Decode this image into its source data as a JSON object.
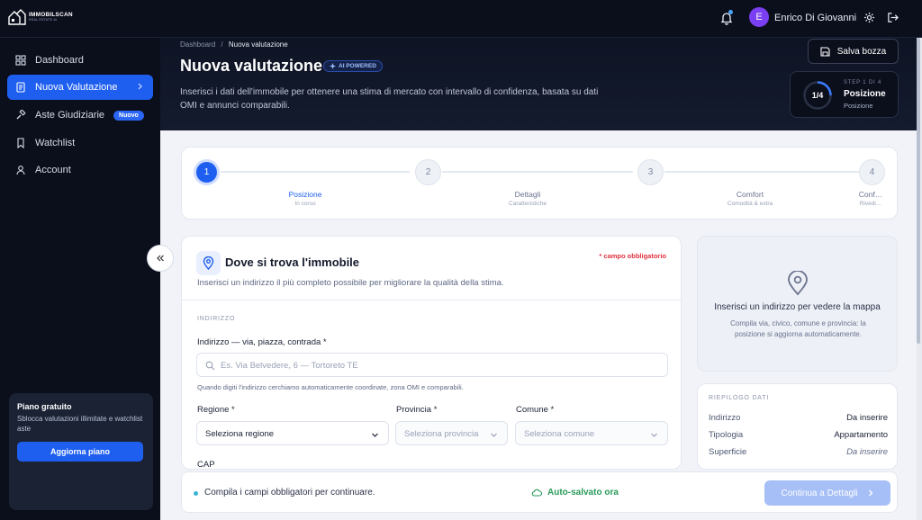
{
  "app": {
    "logo_name": "IMMOBILSCAN",
    "logo_tagline": "REAL ESTATE AI"
  },
  "topbar": {
    "user_initial": "E",
    "user_name": "Enrico Di Giovanni"
  },
  "sidebar": {
    "items": [
      {
        "label": "Dashboard",
        "icon": "dashboard-icon"
      },
      {
        "label": "Nuova Valutazione",
        "icon": "document-icon"
      },
      {
        "label": "Aste Giudiziarie",
        "icon": "gavel-icon",
        "badge": "Nuovo"
      },
      {
        "label": "Watchlist",
        "icon": "bookmark-icon"
      },
      {
        "label": "Account",
        "icon": "user-icon"
      }
    ],
    "promo": {
      "title": "Piano gratuito",
      "text": "Sblocca valutazioni illimitate e watchlist aste",
      "button": "Aggiorna piano"
    }
  },
  "header": {
    "breadcrumb_root": "Dashboard",
    "breadcrumb_sep": "/",
    "breadcrumb_current": "Nuova valutazione",
    "title": "Nuova valutazione",
    "ai_badge": "AI POWERED",
    "subtitle": "Inserisci i dati dell'immobile per ottenere una stima di mercato con intervallo di confidenza, basata su dati OMI e annunci comparabili.",
    "save_button": "Salva bozza",
    "step_fraction": "1/4",
    "step_of": "STEP 1 DI 4",
    "step_title": "Posizione",
    "step_subtitle": "Posizione",
    "step_progress": 0.25
  },
  "stepper": {
    "steps": [
      {
        "number": "1",
        "label": "Posizione",
        "sub": "In corso",
        "active": true
      },
      {
        "number": "2",
        "label": "Dettagli",
        "sub": "Caratteristiche",
        "active": false
      },
      {
        "number": "3",
        "label": "Comfort",
        "sub": "Comodità & extra",
        "active": false
      },
      {
        "number": "4",
        "label": "Conf…",
        "sub": "Rivedi…",
        "active": false
      }
    ]
  },
  "form": {
    "title": "Dove si trova l'immobile",
    "required_note": "* campo obbligatorio",
    "subtitle": "Inserisci un indirizzo il più completo possibile per migliorare la qualità della stima.",
    "section_label": "INDIRIZZO",
    "address_label": "Indirizzo — via, piazza, contrada *",
    "address_placeholder": "Es. Via Belvedere, 6 — Tortoreto TE",
    "address_hint": "Quando digiti l'indirizzo cerchiamo automaticamente coordinate, zona OMI e comparabili.",
    "region_label": "Regione *",
    "region_value": "Seleziona regione",
    "province_label": "Provincia *",
    "province_value": "Seleziona provincia",
    "comune_label": "Comune *",
    "comune_value": "Seleziona comune",
    "cap_label": "CAP"
  },
  "map": {
    "title": "Inserisci un indirizzo per vedere la mappa",
    "text": "Compila via, civico, comune e provincia: la posizione si aggiorna automaticamente."
  },
  "summary": {
    "title": "RIEPILOGO DATI",
    "rows": [
      {
        "key": "Indirizzo",
        "value": "Da inserire"
      },
      {
        "key": "Tipologia",
        "value": "Appartamento"
      },
      {
        "key": "Superficie",
        "value": "Da inserire"
      }
    ]
  },
  "bottom": {
    "message": "Compila i campi obbligatori per continuare.",
    "autosave": "Auto-salvato ora",
    "continue_button": "Continua a Dettagli"
  },
  "colors": {
    "accent": "#1f5ff0",
    "dark": "#0b0f1c",
    "required": "#e0313f",
    "saved": "#2a9a5a"
  }
}
